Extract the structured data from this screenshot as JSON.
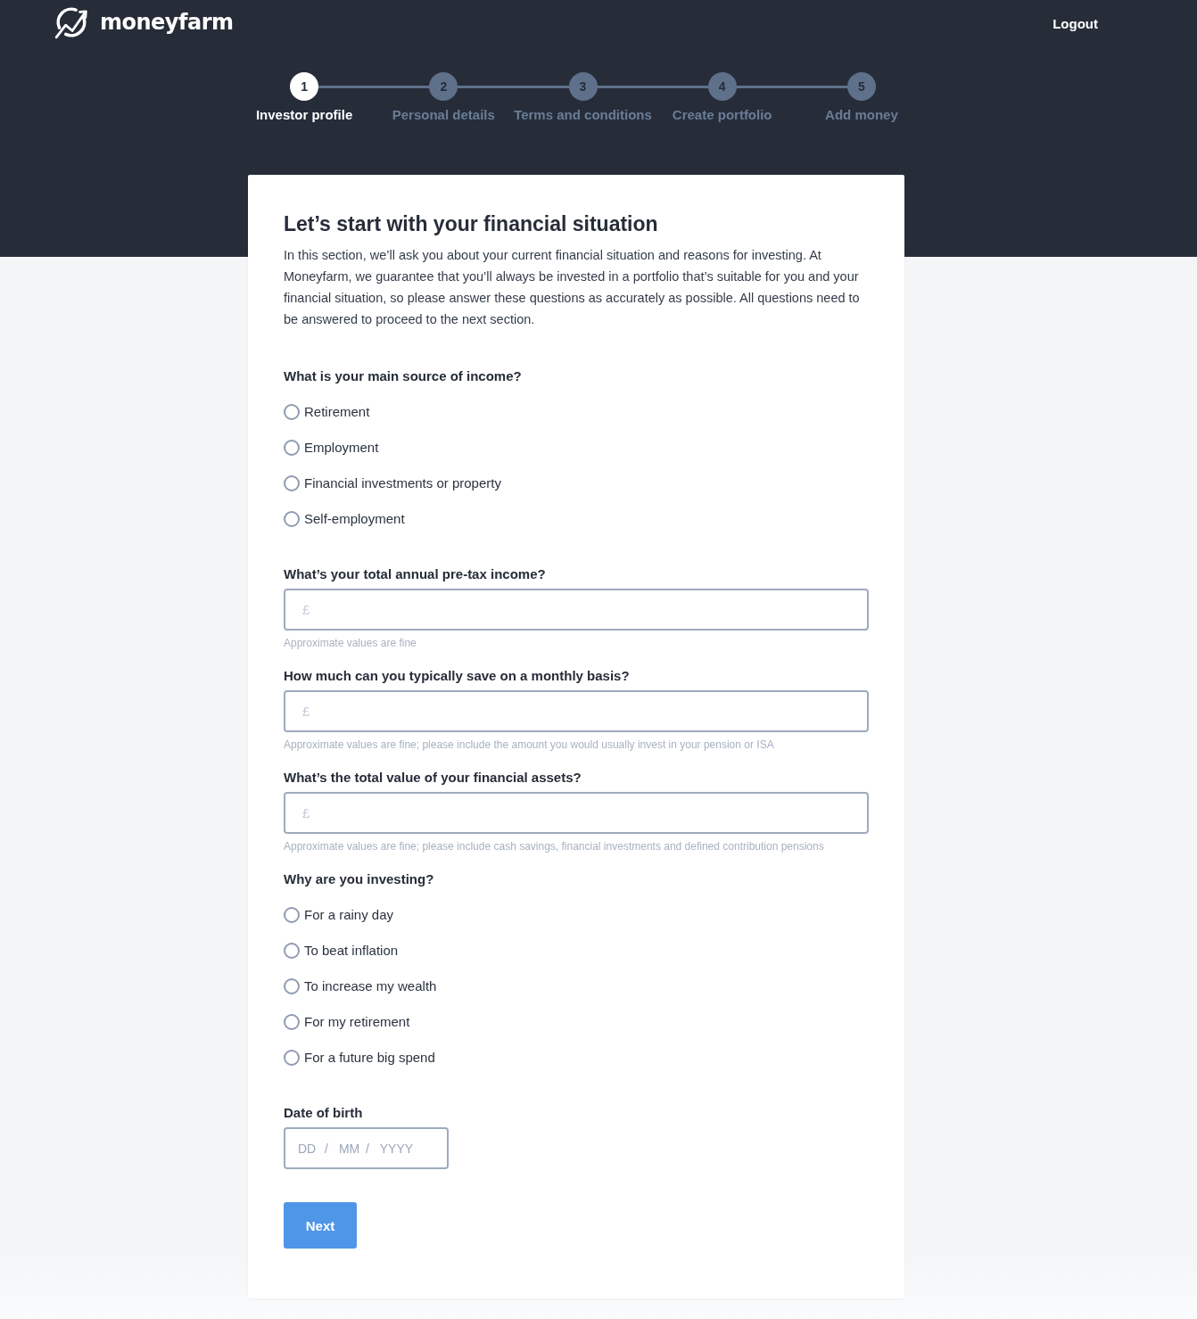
{
  "header": {
    "brand": "moneyfarm",
    "logout": "Logout"
  },
  "steps": [
    {
      "number": "1",
      "label": "Investor profile",
      "selected": true
    },
    {
      "number": "2",
      "label": "Personal details",
      "selected": false
    },
    {
      "number": "3",
      "label": "Terms and conditions",
      "selected": false
    },
    {
      "number": "4",
      "label": "Create portfolio",
      "selected": false
    },
    {
      "number": "5",
      "label": "Add money",
      "selected": false
    }
  ],
  "form": {
    "title": "Let’s start with your financial situation",
    "intro": "In this section, we’ll ask you about your current financial situation and reasons for investing. At Moneyfarm, we guarantee that you’ll always be invested in a portfolio that’s suitable for you and your financial situation, so please answer these questions as accurately as possible. All questions need to be answered to proceed to the next section.",
    "questions": [
      {
        "kind": "radio",
        "label": "What is your main source of income?",
        "options": [
          {
            "label": "Retirement",
            "selected": false
          },
          {
            "label": "Employment",
            "selected": false
          },
          {
            "label": "Financial investments or property",
            "selected": false
          },
          {
            "label": "Self-employment",
            "selected": false
          }
        ]
      },
      {
        "kind": "amount",
        "label": "What’s your total annual pre-tax income?",
        "placeholder": "£",
        "hint": "Approximate values are fine"
      },
      {
        "kind": "amount",
        "label": "How much can you typically save on a monthly basis?",
        "placeholder": "£",
        "hint": "Approximate values are fine; please include the amount you would usually invest in your pension or ISA"
      },
      {
        "kind": "amount",
        "label": "What’s the total value of your financial assets?",
        "placeholder": "£",
        "hint": "Approximate values are fine; please include cash savings, financial investments and defined contribution pensions"
      },
      {
        "kind": "radio",
        "label": "Why are you investing?",
        "options": [
          {
            "label": "For a rainy day",
            "selected": false
          },
          {
            "label": "To beat inflation",
            "selected": false
          },
          {
            "label": "To increase my wealth",
            "selected": false
          },
          {
            "label": "For my retirement",
            "selected": false
          },
          {
            "label": "For a future big spend",
            "selected": false
          }
        ]
      },
      {
        "kind": "date",
        "label": "Date of birth",
        "parts": [
          {
            "kind": "input",
            "placeholder": "DD"
          },
          {
            "kind": "separator",
            "text": "/"
          },
          {
            "kind": "input",
            "placeholder": "MM"
          },
          {
            "kind": "separator",
            "text": "/"
          },
          {
            "kind": "input",
            "placeholder": "YYYY"
          }
        ]
      }
    ],
    "next_button": "Next"
  }
}
